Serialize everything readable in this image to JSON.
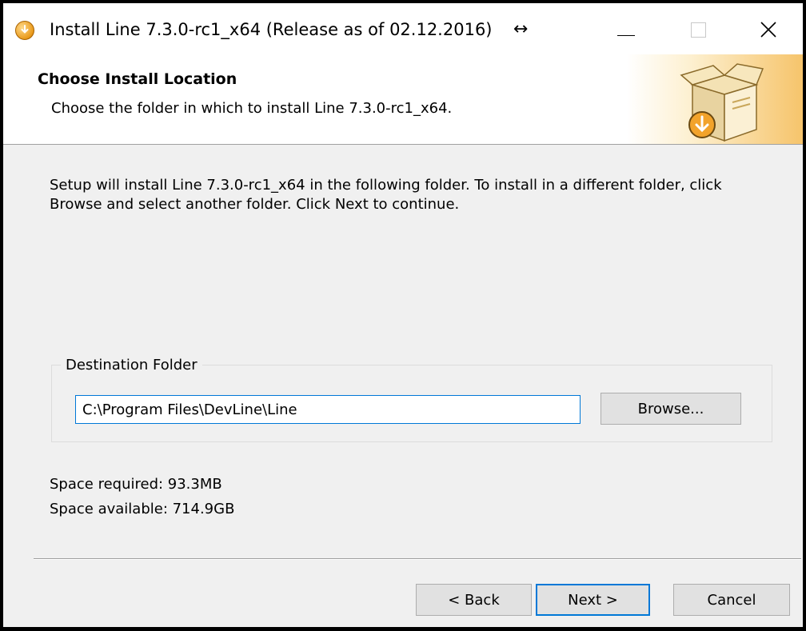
{
  "window": {
    "title": "Install Line 7.3.0-rc1_x64 (Release as of 02.12.2016)",
    "resize_glyph": "↔",
    "controls": [
      "minimize-icon",
      "maximize-icon",
      "close-icon"
    ]
  },
  "header": {
    "title": "Choose Install Location",
    "subtitle": "Choose the folder in which to install Line 7.3.0-rc1_x64."
  },
  "body": {
    "instructions": "Setup will install Line 7.3.0-rc1_x64 in the following folder. To install in a different folder, click Browse and select another folder. Click Next to continue."
  },
  "destination": {
    "legend": "Destination Folder",
    "path": "C:\\Program Files\\DevLine\\Line",
    "browse_label": "Browse..."
  },
  "space": {
    "required": "Space required: 93.3MB",
    "available": "Space available: 714.9GB"
  },
  "footer": {
    "back_label": "< Back",
    "next_label": "Next >",
    "cancel_label": "Cancel"
  },
  "colors": {
    "accent": "#0078d7",
    "header_gradient_end": "#f6c46b",
    "dialog_background": "#f0f0f0"
  }
}
